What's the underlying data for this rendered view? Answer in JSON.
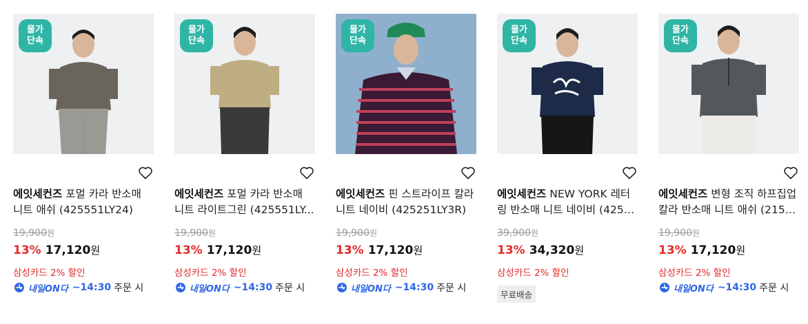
{
  "colors": {
    "accent_red": "#e12b2b",
    "badge_teal": "#2fb5a6",
    "delivery_blue": "#2d67e6"
  },
  "products": [
    {
      "badge_line1": "물가",
      "badge_line2": "단속",
      "brand": "에잇세컨즈",
      "name_line1": "포멀 카라 반소매",
      "name_line2": "니트 애쉬 (425551LY24)",
      "original_price": "19,900",
      "original_unit": "원",
      "discount_rate": "13%",
      "sale_price": "17,120",
      "sale_unit": "원",
      "card_discount": "삼성카드 2% 할인",
      "delivery_brand": "내일ON다",
      "delivery_time": "~14:30",
      "delivery_suffix": "주문 시",
      "free_shipping": null,
      "wishlist_icon": "heart-outline-icon"
    },
    {
      "badge_line1": "물가",
      "badge_line2": "단속",
      "brand": "에잇세컨즈",
      "name_line1": "포멀 카라 반소매",
      "name_line2": "니트 라이트그린 (425551LY...",
      "original_price": "19,900",
      "original_unit": "원",
      "discount_rate": "13%",
      "sale_price": "17,120",
      "sale_unit": "원",
      "card_discount": "삼성카드 2% 할인",
      "delivery_brand": "내일ON다",
      "delivery_time": "~14:30",
      "delivery_suffix": "주문 시",
      "free_shipping": null,
      "wishlist_icon": "heart-outline-icon"
    },
    {
      "badge_line1": "물가",
      "badge_line2": "단속",
      "brand": "에잇세컨즈",
      "name_line1": "핀 스트라이프 칼라",
      "name_line2": "니트 네이비 (425251LY3R)",
      "original_price": "19,900",
      "original_unit": "원",
      "discount_rate": "13%",
      "sale_price": "17,120",
      "sale_unit": "원",
      "card_discount": "삼성카드 2% 할인",
      "delivery_brand": "내일ON다",
      "delivery_time": "~14:30",
      "delivery_suffix": "주문 시",
      "free_shipping": null,
      "wishlist_icon": "heart-outline-icon"
    },
    {
      "badge_line1": "물가",
      "badge_line2": "단속",
      "brand": "에잇세컨즈",
      "name_line1": "NEW YORK 레터",
      "name_line2": "링 반소매 니트 네이비 (4255...",
      "original_price": "39,900",
      "original_unit": "원",
      "discount_rate": "13%",
      "sale_price": "34,320",
      "sale_unit": "원",
      "card_discount": "삼성카드 2% 할인",
      "delivery_brand": null,
      "delivery_time": null,
      "delivery_suffix": null,
      "free_shipping": "무료배송",
      "wishlist_icon": "heart-outline-icon"
    },
    {
      "badge_line1": "물가",
      "badge_line2": "단속",
      "brand": "에잇세컨즈",
      "name_line1": "변형 조직 하프집업",
      "name_line2": "칼라 반소매 니트 애쉬 (2154...",
      "original_price": "19,900",
      "original_unit": "원",
      "discount_rate": "13%",
      "sale_price": "17,120",
      "sale_unit": "원",
      "card_discount": "삼성카드 2% 할인",
      "delivery_brand": "내일ON다",
      "delivery_time": "~14:30",
      "delivery_suffix": "주문 시",
      "free_shipping": null,
      "wishlist_icon": "heart-outline-icon"
    }
  ]
}
